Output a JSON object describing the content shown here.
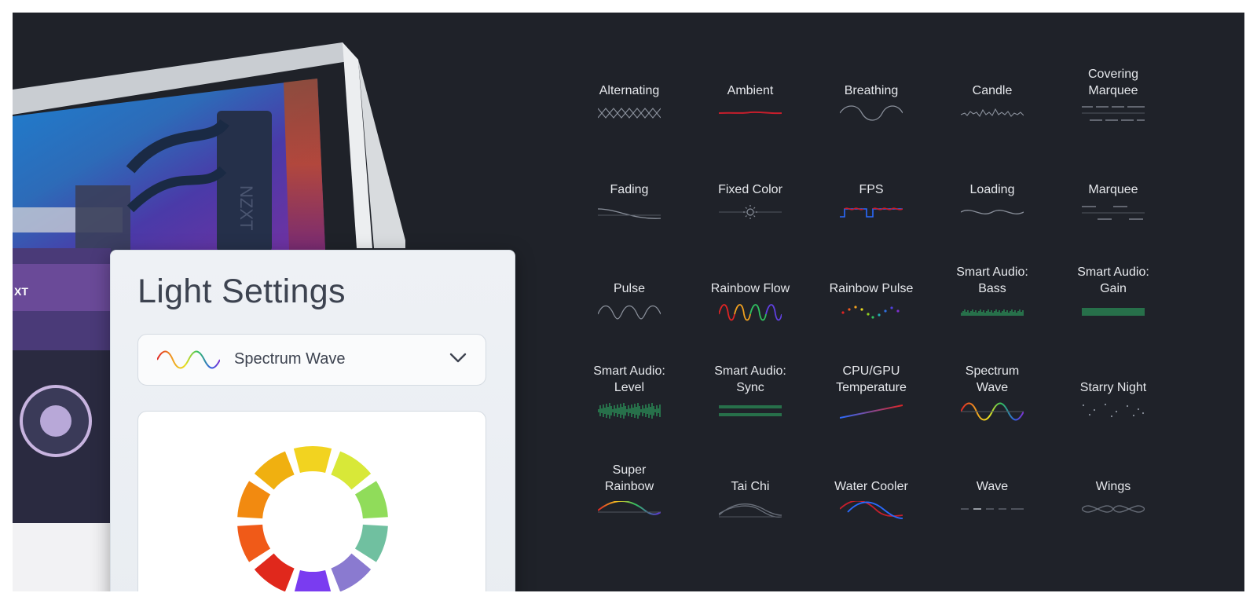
{
  "panel": {
    "title": "Light Settings",
    "selected_effect": "Spectrum Wave",
    "selected_icon": "spectrum-wave-icon",
    "dropdown_icon": "chevron-down-icon"
  },
  "effects": [
    {
      "label": "Alternating",
      "icon": "alternating-icon"
    },
    {
      "label": "Ambient",
      "icon": "ambient-icon"
    },
    {
      "label": "Breathing",
      "icon": "breathing-icon"
    },
    {
      "label": "Candle",
      "icon": "candle-icon"
    },
    {
      "label": "Covering\nMarquee",
      "icon": "covering-marquee-icon"
    },
    {
      "label": "Fading",
      "icon": "fading-icon"
    },
    {
      "label": "Fixed Color",
      "icon": "fixed-color-icon"
    },
    {
      "label": "FPS",
      "icon": "fps-icon"
    },
    {
      "label": "Loading",
      "icon": "loading-icon"
    },
    {
      "label": "Marquee",
      "icon": "marquee-icon"
    },
    {
      "label": "Pulse",
      "icon": "pulse-icon"
    },
    {
      "label": "Rainbow Flow",
      "icon": "rainbow-flow-icon"
    },
    {
      "label": "Rainbow Pulse",
      "icon": "rainbow-pulse-icon"
    },
    {
      "label": "Smart Audio:\nBass",
      "icon": "smart-audio-bass-icon"
    },
    {
      "label": "Smart Audio:\nGain",
      "icon": "smart-audio-gain-icon"
    },
    {
      "label": "Smart Audio:\nLevel",
      "icon": "smart-audio-level-icon"
    },
    {
      "label": "Smart Audio:\nSync",
      "icon": "smart-audio-sync-icon"
    },
    {
      "label": "CPU/GPU\nTemperature",
      "icon": "cpu-gpu-temperature-icon"
    },
    {
      "label": "Spectrum\nWave",
      "icon": "spectrum-wave-icon"
    },
    {
      "label": "Starry Night",
      "icon": "starry-night-icon"
    },
    {
      "label": "Super\nRainbow",
      "icon": "super-rainbow-icon"
    },
    {
      "label": "Tai Chi",
      "icon": "tai-chi-icon"
    },
    {
      "label": "Water Cooler",
      "icon": "water-cooler-icon"
    },
    {
      "label": "Wave",
      "icon": "wave-icon"
    },
    {
      "label": "Wings",
      "icon": "wings-icon"
    }
  ],
  "colors": {
    "background": "#1f2229",
    "label": "#e6e8ec",
    "icon_gray": "#8a909b",
    "audio_green": "#2fbf6a",
    "ambient_red": "#c81e2c",
    "fps_blue": "#2a6bff"
  }
}
